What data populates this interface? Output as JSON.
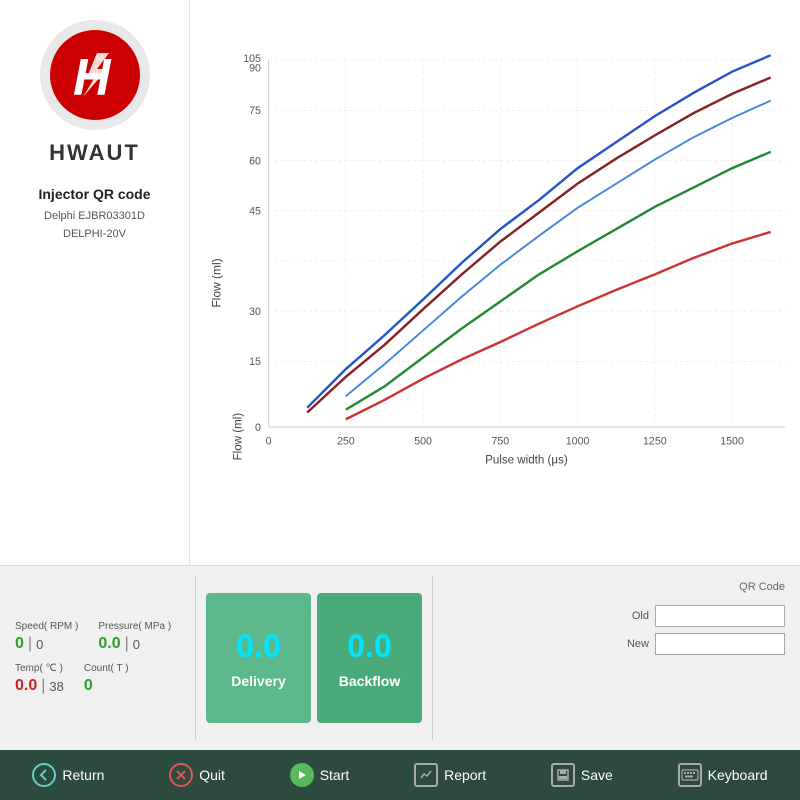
{
  "sidebar": {
    "brand": "HWAUT",
    "title": "Injector QR code",
    "subtitle_line1": "Delphi  EJBR03301D",
    "subtitle_line2": "DELPHI-20V"
  },
  "chart": {
    "y_axis_label": "Flow (ml)",
    "x_axis_label": "Pulse width (μs)",
    "y_ticks": [
      "0",
      "15",
      "30",
      "45",
      "60",
      "75",
      "90",
      "105"
    ],
    "x_ticks": [
      "0",
      "250",
      "500",
      "750",
      "1000",
      "1250",
      "1500"
    ]
  },
  "stats": {
    "speed_label": "Speed( RPM )",
    "speed_value": "0",
    "speed_sub": "0",
    "pressure_label": "Pressure( MPa )",
    "pressure_value": "0.0",
    "pressure_sub": "0",
    "temp_label": "Temp( ℃ )",
    "temp_value": "0.0",
    "temp_sub": "38",
    "count_label": "Count( T )",
    "count_value": "0"
  },
  "metrics": {
    "delivery_value": "0.0",
    "delivery_label": "Delivery",
    "backflow_value": "0.0",
    "backflow_label": "Backflow"
  },
  "qr": {
    "title": "QR Code",
    "old_label": "Old",
    "new_label": "New",
    "old_value": "",
    "new_value": ""
  },
  "toolbar": {
    "return_label": "Return",
    "quit_label": "Quit",
    "start_label": "Start",
    "report_label": "Report",
    "save_label": "Save",
    "keyboard_label": "Keyboard"
  }
}
